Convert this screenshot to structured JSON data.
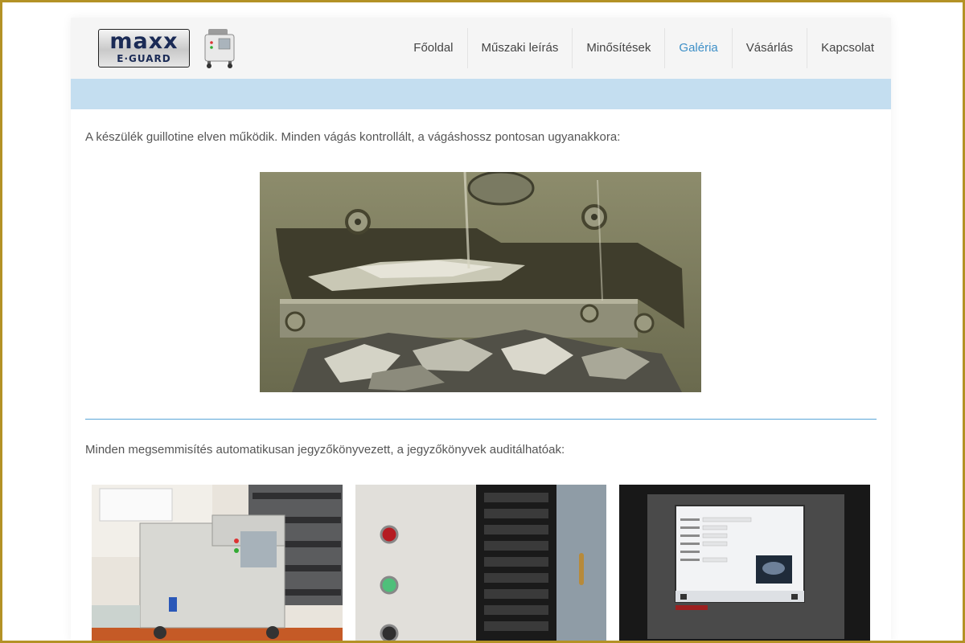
{
  "brand": {
    "logo_line1": "maxx",
    "logo_line2": "E·GUARD"
  },
  "nav": {
    "items": [
      {
        "label": "Főoldal",
        "active": false
      },
      {
        "label": "Műszaki leírás",
        "active": false
      },
      {
        "label": "Minősítések",
        "active": false
      },
      {
        "label": "Galéria",
        "active": true
      },
      {
        "label": "Vásárlás",
        "active": false
      },
      {
        "label": "Kapcsolat",
        "active": false
      }
    ]
  },
  "content": {
    "intro_text": "A készülék guillotine elven működik. Minden vágás kontrollált, a vágáshossz pontosan ugyanakkora:",
    "protocol_text": "Minden megsemmisítés automatikusan jegyzőkönyvezett, a jegyzőkönyvek auditálhatóak:"
  },
  "colors": {
    "accent": "#3d8fc7",
    "band": "#c4def0",
    "frame": "#b39226"
  }
}
